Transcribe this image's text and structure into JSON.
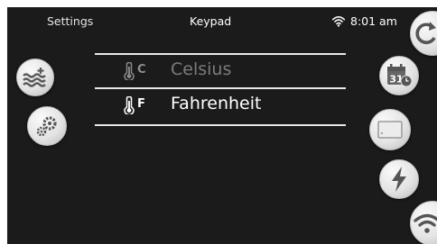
{
  "topbar": {
    "left_label": "Settings",
    "title": "Keypad",
    "time": "8:01 am",
    "wifi_icon": "wifi-icon"
  },
  "temperature_units": {
    "selected": "fahrenheit",
    "options": [
      {
        "id": "celsius",
        "symbol": "C",
        "label": "Celsius",
        "icon": "thermometer-icon"
      },
      {
        "id": "fahrenheit",
        "symbol": "F",
        "label": "Fahrenheit",
        "icon": "thermometer-icon"
      }
    ]
  },
  "left_buttons": [
    {
      "name": "water-heat-button",
      "icon": "water-waves-plus-icon"
    },
    {
      "name": "settings-button",
      "icon": "gears-icon"
    }
  ],
  "right_buttons": [
    {
      "name": "refresh-button",
      "icon": "refresh-icon"
    },
    {
      "name": "calendar-schedule-button",
      "icon": "calendar-clock-icon",
      "text": "31"
    },
    {
      "name": "display-button",
      "icon": "screen-icon"
    },
    {
      "name": "power-button",
      "icon": "lightning-icon"
    },
    {
      "name": "wifi-button",
      "icon": "wifi-icon"
    }
  ],
  "colors": {
    "background": "#1b1b1b",
    "text_selected": "#ffffff",
    "text_unselected": "#7c7c7c",
    "button_face": "#e4e4e4",
    "icon_dark": "#555555"
  }
}
